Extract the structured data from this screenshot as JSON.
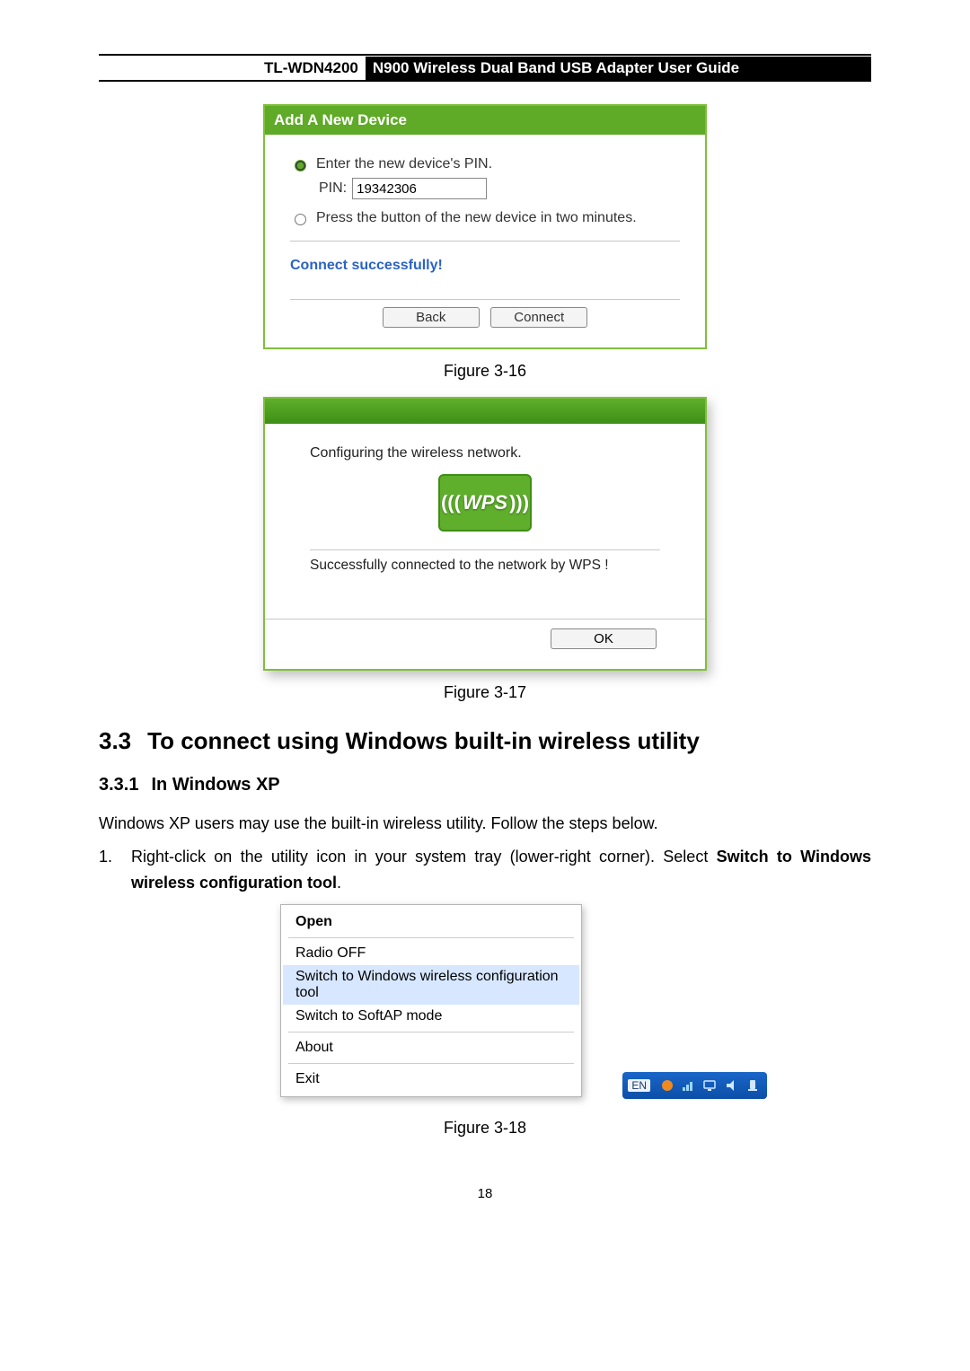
{
  "header": {
    "model": "TL-WDN4200",
    "title": "N900 Wireless Dual Band USB Adapter User Guide"
  },
  "fig316": {
    "title": "Add A New Device",
    "option_pin": "Enter the new device's PIN.",
    "pin_label": "PIN:",
    "pin_value": "19342306",
    "option_btn": "Press the button of the new device in two minutes.",
    "status": "Connect successfully!",
    "back": "Back",
    "connect": "Connect",
    "caption": "Figure 3-16"
  },
  "fig317": {
    "configuring": "Configuring the wireless network.",
    "wps_label": "WPS",
    "success": "Successfully connected to the network by WPS !",
    "ok": "OK",
    "caption": "Figure 3-17"
  },
  "section": {
    "h2_num": "3.3",
    "h2_text": "To connect using Windows built-in wireless utility",
    "h3_num": "3.3.1",
    "h3_text": "In Windows XP",
    "para": "Windows XP users may use the built-in wireless utility. Follow the steps below.",
    "step_num": "1.",
    "step_text_a": "Right-click on the utility icon in your system tray (lower-right corner). Select ",
    "step_bold": "Switch to Windows wireless configuration tool",
    "step_period": "."
  },
  "fig318": {
    "menu": {
      "open": "Open",
      "radio_off": "Radio OFF",
      "switch_win": "Switch to Windows wireless configuration tool",
      "switch_softap": "Switch to SoftAP mode",
      "about": "About",
      "exit": "Exit"
    },
    "tray_lang": "EN",
    "caption": "Figure 3-18"
  },
  "page_number": "18"
}
